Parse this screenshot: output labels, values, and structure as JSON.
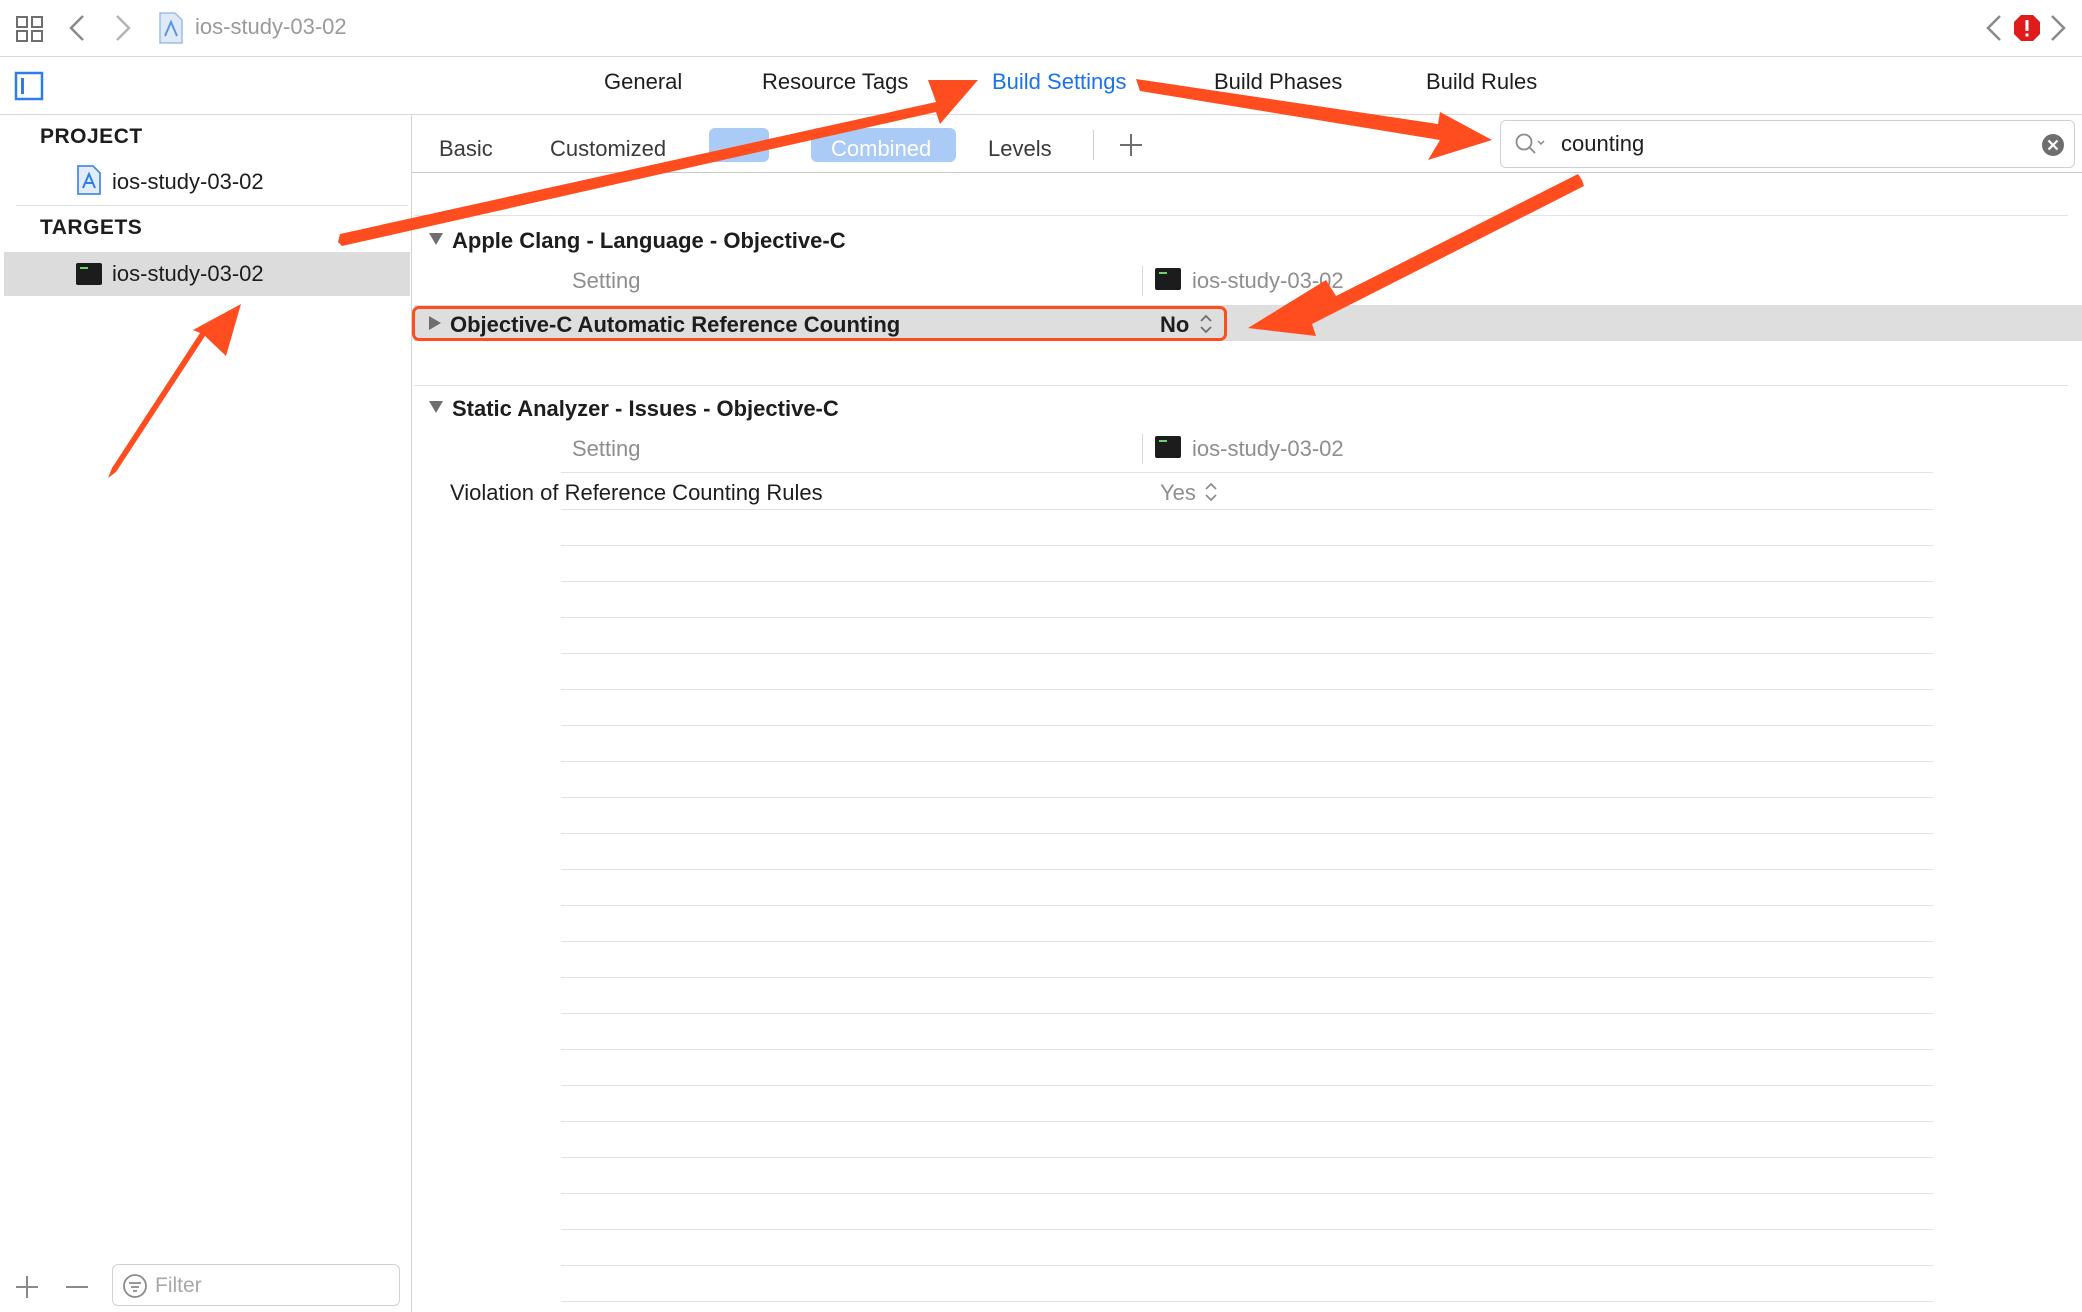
{
  "window": {
    "breadcrumb": "ios-study-03-02"
  },
  "editor_tabs": [
    {
      "label": "General"
    },
    {
      "label": "Resource Tags"
    },
    {
      "label": "Build Settings"
    },
    {
      "label": "Build Phases"
    },
    {
      "label": "Build Rules"
    }
  ],
  "sidebar": {
    "project_header": "PROJECT",
    "project_item": "ios-study-03-02",
    "targets_header": "TARGETS",
    "target_item": "ios-study-03-02",
    "filter_placeholder": "Filter"
  },
  "scope_bar": {
    "basic": "Basic",
    "customized": "Customized",
    "combined": "Combined",
    "levels": "Levels",
    "add": "+"
  },
  "search": {
    "value": "counting"
  },
  "groups": [
    {
      "title": "Apple Clang - Language - Objective-C",
      "setting_header": "Setting",
      "target_header": "ios-study-03-02",
      "rows": [
        {
          "name": "Objective-C Automatic Reference Counting",
          "value": "No"
        }
      ]
    },
    {
      "title": "Static Analyzer - Issues - Objective-C",
      "setting_header": "Setting",
      "target_header": "ios-study-03-02",
      "rows": [
        {
          "name": "Violation of Reference Counting Rules",
          "value": "Yes"
        }
      ]
    }
  ],
  "colors": {
    "accent": "#1a73e8",
    "annotation": "#ff4d1f",
    "selected_row": "#dcdcdc",
    "error": "#e01b1b"
  },
  "icons": {
    "grid": "grid-icon",
    "back": "chevron-left-icon",
    "forward": "chevron-right-icon",
    "file": "xcodeproj-file-icon",
    "error": "error-icon",
    "sidebar_toggle": "sidebar-toggle-icon",
    "search": "magnifier-icon",
    "clear": "clear-circle-icon",
    "filter": "filter-icon",
    "stepper": "updown-stepper-icon"
  }
}
